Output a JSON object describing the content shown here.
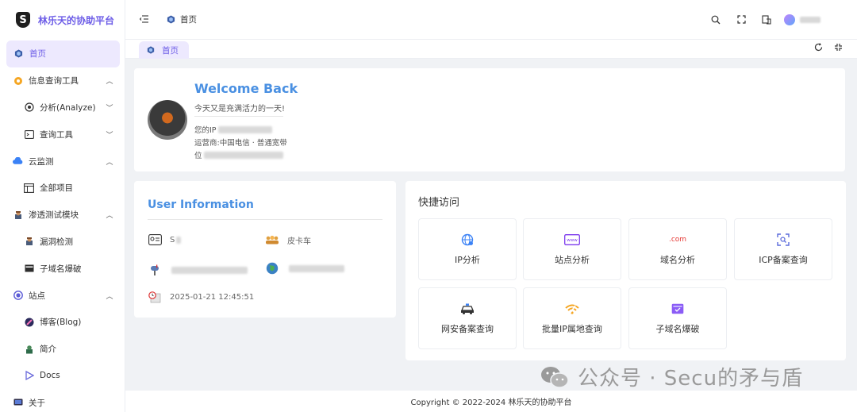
{
  "brand": {
    "logo_letter": "S",
    "title": "林乐天的协助平台"
  },
  "sidebar": {
    "items": [
      {
        "label": "首页",
        "icon": "hexagon-icon",
        "active": true
      },
      {
        "label": "信息查询工具",
        "icon": "cog-icon",
        "expanded": true
      },
      {
        "label": "分析(Analyze)",
        "icon": "eye-target-icon",
        "child": true,
        "chevron": "down"
      },
      {
        "label": "查询工具",
        "icon": "terminal-icon",
        "child": true,
        "chevron": "down"
      },
      {
        "label": "云监测",
        "icon": "cloud-icon",
        "expanded": true
      },
      {
        "label": "全部项目",
        "icon": "project-board-icon",
        "child": true
      },
      {
        "label": "渗透测试模块",
        "icon": "hacker-icon",
        "expanded": true
      },
      {
        "label": "漏洞检测",
        "icon": "bug-scan-icon",
        "child": true
      },
      {
        "label": "子域名爆破",
        "icon": "mail-icon",
        "child": true
      },
      {
        "label": "站点",
        "icon": "target-circle-icon",
        "expanded": true
      },
      {
        "label": "博客(Blog)",
        "icon": "blog-rocket-icon",
        "child": true
      },
      {
        "label": "简介",
        "icon": "profile-icon",
        "child": true
      },
      {
        "label": "Docs",
        "icon": "docs-icon",
        "child": true
      },
      {
        "label": "关于",
        "icon": "monitor-icon"
      }
    ]
  },
  "topbar": {
    "breadcrumb": "首页"
  },
  "tabs": [
    {
      "label": "首页"
    }
  ],
  "welcome": {
    "title": "Welcome Back",
    "subtitle": "今天又是充满活力的一天!",
    "ip_label": "您的IP",
    "isp_label": "运营商:中国电信 · 普通宽带",
    "location_label": "位"
  },
  "user_info": {
    "title": "User Information",
    "name": "S",
    "theme": "皮卡车",
    "timestamp": "2025-01-21 12:45:51"
  },
  "quick_access": {
    "title": "快捷访问",
    "tiles": [
      {
        "label": "IP分析",
        "icon": "globe-gear-icon"
      },
      {
        "label": "站点分析",
        "icon": "www-icon"
      },
      {
        "label": "域名分析",
        "icon": "dotcom-icon",
        "icon_text": ".com"
      },
      {
        "label": "ICP备案查询",
        "icon": "scan-search-icon"
      },
      {
        "label": "网安备案查询",
        "icon": "police-car-icon"
      },
      {
        "label": "批量IP属地查询",
        "icon": "wifi-signal-icon"
      },
      {
        "label": "子域名爆破",
        "icon": "mail-check-icon"
      }
    ]
  },
  "footer": {
    "copyright": "Copyright © 2022-2024 林乐天的协助平台"
  },
  "watermark": {
    "text": "公众号 · Secu的矛与盾"
  },
  "colors": {
    "accent": "#6c5ce7",
    "title_blue": "#4a90e2",
    "active_bg": "#ede9fe"
  }
}
